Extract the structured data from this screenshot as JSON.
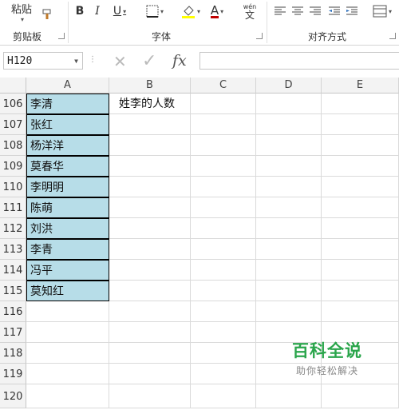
{
  "ribbon": {
    "clipboard": {
      "paste_label": "粘贴",
      "group_label": "剪贴板"
    },
    "font": {
      "bold": "B",
      "italic": "I",
      "underline": "U",
      "font_color": "A",
      "phonetic_top": "wén",
      "phonetic_bottom": "文",
      "group_label": "字体",
      "font_color_value": "#c00000",
      "fill_color_value": "#ffff00"
    },
    "alignment": {
      "group_label": "对齐方式"
    }
  },
  "formula_bar": {
    "name_box": "H120",
    "cancel_symbol": "✕",
    "enter_symbol": "✓",
    "function_symbol": "fx",
    "formula_value": ""
  },
  "sheet": {
    "columns": [
      "A",
      "B",
      "C",
      "D",
      "E"
    ],
    "rows": [
      {
        "num": "106",
        "a": "李清",
        "b": "姓李的人数"
      },
      {
        "num": "107",
        "a": "张红",
        "b": ""
      },
      {
        "num": "108",
        "a": "杨洋洋",
        "b": ""
      },
      {
        "num": "109",
        "a": "莫春华",
        "b": ""
      },
      {
        "num": "110",
        "a": "李明明",
        "b": ""
      },
      {
        "num": "111",
        "a": "陈萌",
        "b": ""
      },
      {
        "num": "112",
        "a": "刘洪",
        "b": ""
      },
      {
        "num": "113",
        "a": "李青",
        "b": ""
      },
      {
        "num": "114",
        "a": "冯平",
        "b": ""
      },
      {
        "num": "115",
        "a": "莫知红",
        "b": ""
      },
      {
        "num": "116",
        "a": "",
        "b": ""
      },
      {
        "num": "117",
        "a": "",
        "b": ""
      },
      {
        "num": "118",
        "a": "",
        "b": ""
      },
      {
        "num": "119",
        "a": "",
        "b": ""
      },
      {
        "num": "120",
        "a": "",
        "b": ""
      }
    ],
    "filled_color": "#b7dde8"
  },
  "watermark": {
    "title": "百科全说",
    "subtitle": "助你轻松解决",
    "color": "#2aa54b"
  }
}
